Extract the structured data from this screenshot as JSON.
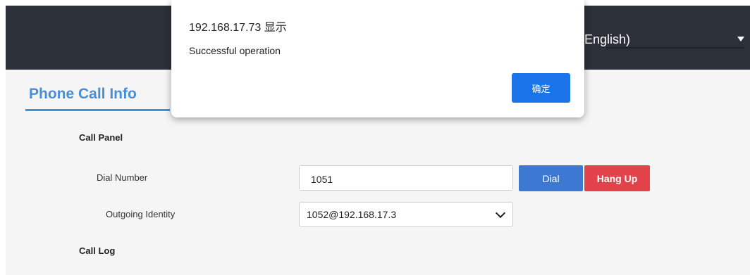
{
  "header": {
    "language_select": "sh (English)"
  },
  "page": {
    "tab_label": "Phone Call Info"
  },
  "call_panel": {
    "title": "Call Panel",
    "dial_number_label": "Dial Number",
    "dial_number_value": "1051",
    "dial_button": "Dial",
    "hangup_button": "Hang Up",
    "outgoing_identity_label": "Outgoing Identity",
    "outgoing_identity_value": "1052@192.168.17.3"
  },
  "call_log": {
    "title": "Call Log"
  },
  "dialog": {
    "origin": "192.168.17.73 显示",
    "message": "Successful operation",
    "ok_button": "确定",
    "ok_button_color": "#1a73e8"
  },
  "colors": {
    "header_bg": "#2c3038",
    "tab_accent": "#4a8fd6",
    "dial_button": "#3d78d2",
    "hangup_button": "#e2434a"
  }
}
